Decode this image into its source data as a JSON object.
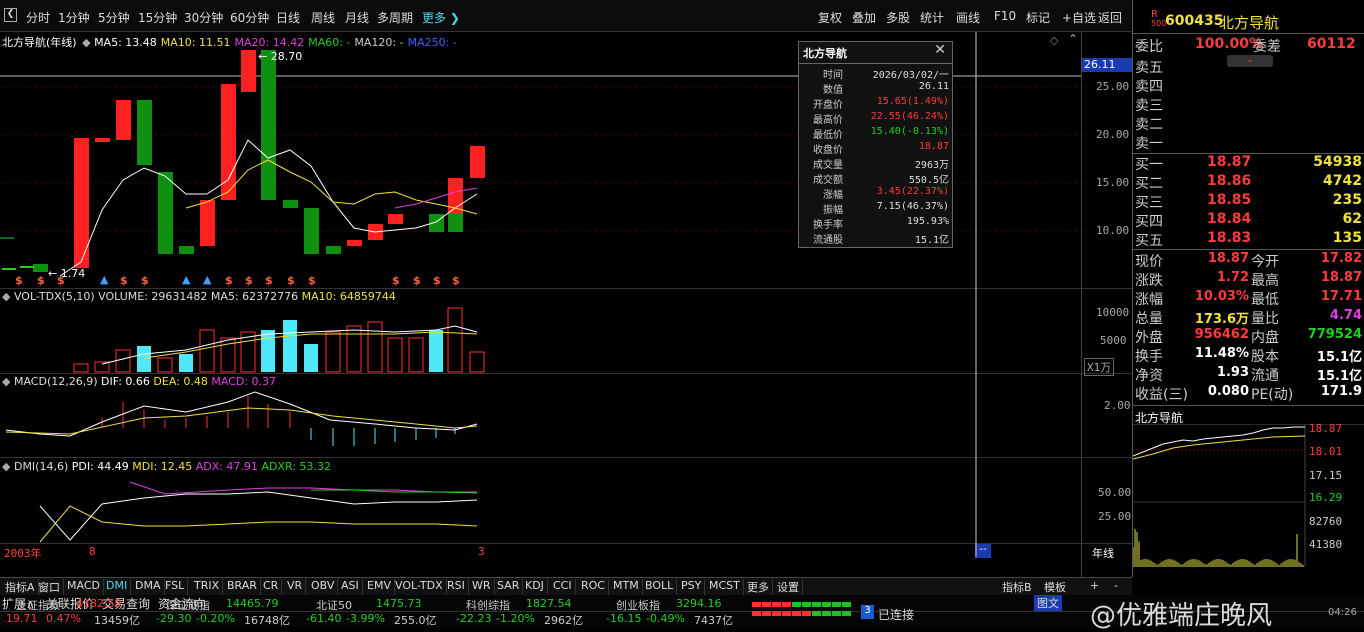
{
  "toolbar": {
    "left_items": [
      "分时",
      "1分钟",
      "5分钟",
      "15分钟",
      "30分钟",
      "60分钟",
      "日线",
      "周线",
      "月线",
      "多周期"
    ],
    "more": "更多",
    "right_items": [
      "复权",
      "叠加",
      "多股",
      "统计",
      "画线",
      "F10",
      "标记",
      "+自选",
      "返回"
    ]
  },
  "main": {
    "stock_name": "北方导航",
    "period": "(年线)",
    "ma": [
      {
        "label": "MA5: 13.48",
        "color": "#ffffff"
      },
      {
        "label": "MA10: 11.51",
        "color": "#f0e040"
      },
      {
        "label": "MA20: 14.42",
        "color": "#e040e0"
      },
      {
        "label": "MA60: -",
        "color": "#20d020"
      },
      {
        "label": "MA120: -",
        "color": "#cccccc"
      },
      {
        "label": "MA250: -",
        "color": "#4060ff"
      }
    ],
    "price_axis": [
      "25.00",
      "20.00",
      "15.00",
      "10.00"
    ],
    "current_price_tag": "26.11",
    "high_mark": "28.70",
    "low_mark": "1.74"
  },
  "vol": {
    "label": "VOL-TDX(5,10)",
    "volume": "VOLUME: 29631482",
    "ma5": "MA5: 62372776",
    "ma10": "MA10: 64859744",
    "axis": [
      "10000",
      "5000"
    ],
    "unit": "X1万"
  },
  "macd": {
    "label": "MACD(12,26,9)",
    "dif": "DIF: 0.66",
    "dea": "DEA: 0.48",
    "macd": "MACD: 0.37",
    "axis": [
      "2.00"
    ]
  },
  "dmi": {
    "label": "DMI(14,6)",
    "pdi": "PDI: 44.49",
    "mdi": "MDI: 12.45",
    "adx": "ADX: 47.91",
    "adxr": "ADXR: 53.32",
    "axis": [
      "50.00",
      "25.00"
    ]
  },
  "xaxis": {
    "start": "2003年",
    "mark1": "8",
    "mark2": "3",
    "period_label": "年线"
  },
  "tooltip": {
    "title": "北方导航",
    "rows": [
      {
        "k": "时间",
        "v": "2026/03/02/一",
        "c": "white"
      },
      {
        "k": "数值",
        "v": "26.11",
        "c": "white"
      },
      {
        "k": "开盘价",
        "v": "15.65(1.49%)",
        "c": "red"
      },
      {
        "k": "最高价",
        "v": "22.55(46.24%)",
        "c": "red"
      },
      {
        "k": "最低价",
        "v": "15.40(-0.13%)",
        "c": "green"
      },
      {
        "k": "收盘价",
        "v": "18.87",
        "c": "red"
      },
      {
        "k": "成交量",
        "v": "2963万",
        "c": "white"
      },
      {
        "k": "成交额",
        "v": "550.5亿",
        "c": "white"
      },
      {
        "k": "涨幅",
        "v": "3.45(22.37%)",
        "c": "red"
      },
      {
        "k": "振幅",
        "v": "7.15(46.37%)",
        "c": "white"
      },
      {
        "k": "换手率",
        "v": "195.93%",
        "c": "white"
      },
      {
        "k": "流通股",
        "v": "15.1亿",
        "c": "white"
      }
    ]
  },
  "quote": {
    "code": "600435",
    "name": "北方导航",
    "r_badge": "R",
    "sub_badge": "500",
    "weibi_label": "委比",
    "weibi": "100.00%",
    "weicha_label": "委差",
    "weicha": "60112",
    "asks": [
      "卖五",
      "卖四",
      "卖三",
      "卖二",
      "卖一"
    ],
    "bids": [
      {
        "label": "买一",
        "price": "18.87",
        "vol": "54938"
      },
      {
        "label": "买二",
        "price": "18.86",
        "vol": "4742"
      },
      {
        "label": "买三",
        "price": "18.85",
        "vol": "235"
      },
      {
        "label": "买四",
        "price": "18.84",
        "vol": "62"
      },
      {
        "label": "买五",
        "price": "18.83",
        "vol": "135"
      }
    ],
    "stats": [
      {
        "k1": "现价",
        "v1": "18.87",
        "c1": "red",
        "k2": "今开",
        "v2": "17.82",
        "c2": "red"
      },
      {
        "k1": "涨跌",
        "v1": "1.72",
        "c1": "red",
        "k2": "最高",
        "v2": "18.87",
        "c2": "red"
      },
      {
        "k1": "涨幅",
        "v1": "10.03%",
        "c1": "red",
        "k2": "最低",
        "v2": "17.71",
        "c2": "red"
      },
      {
        "k1": "总量",
        "v1": "173.6万",
        "c1": "yellow",
        "k2": "量比",
        "v2": "4.74",
        "c2": "mag"
      },
      {
        "k1": "外盘",
        "v1": "956462",
        "c1": "red",
        "k2": "内盘",
        "v2": "779524",
        "c2": "green"
      },
      {
        "k1": "换手",
        "v1": "11.48%",
        "c1": "white",
        "k2": "股本",
        "v2": "15.1亿",
        "c2": "white"
      },
      {
        "k1": "净资",
        "v1": "1.93",
        "c1": "white",
        "k2": "流通",
        "v2": "15.1亿",
        "c2": "white"
      },
      {
        "k1": "收益(三)",
        "v1": "0.080",
        "c1": "white",
        "k2": "PE(动)",
        "v2": "171.9",
        "c2": "white"
      }
    ],
    "mini_title": "北方导航",
    "mini_axis": [
      "18.87",
      "18.01",
      "17.15",
      "16.29",
      "82760",
      "41380"
    ]
  },
  "indicator_tabs": [
    "指标A",
    "窗口",
    "MACD",
    "DMI",
    "DMA",
    "FSL",
    "TRIX",
    "BRAR",
    "CR",
    "VR",
    "OBV",
    "ASI",
    "EMV",
    "VOL-TDX",
    "RSI",
    "WR",
    "SAR",
    "KDJ",
    "CCI",
    "ROC",
    "MTM",
    "BOLL",
    "PSY",
    "MCST",
    "更多",
    "设置"
  ],
  "indicator_right": [
    "指标B",
    "模板",
    "+",
    "-"
  ],
  "bottom_tabs": [
    "扩展∧",
    "关联报价",
    "交易查询",
    "资金流向"
  ],
  "right_bottom_tab": "图文",
  "indices": [
    {
      "name": "上证指数",
      "value": "4182.59",
      "chg": "19.71",
      "pct": "0.47%",
      "amt": "13459亿",
      "c": "red"
    },
    {
      "name": "深证成指",
      "value": "14465.79",
      "chg": "-29.30",
      "pct": "-0.20%",
      "amt": "16748亿",
      "c": "green"
    },
    {
      "name": "北证50",
      "value": "1475.73",
      "chg": "-61.40",
      "pct": "-3.99%",
      "amt": "255.0亿",
      "c": "green"
    },
    {
      "name": "科创综指",
      "value": "1827.54",
      "chg": "-22.23",
      "pct": "-1.20%",
      "amt": "2962亿",
      "c": "green"
    },
    {
      "name": "创业板指",
      "value": "3294.16",
      "chg": "-16.15",
      "pct": "-0.49%",
      "amt": "7437亿",
      "c": "green"
    }
  ],
  "conn": {
    "badge": "3",
    "text": "已连接"
  },
  "watermark": "@优雅端庄晚风",
  "clock": "04:26",
  "colors": {
    "up": "#ff2020",
    "down": "#109010",
    "cyan": "#4fe8f8",
    "grid": "#333333"
  }
}
